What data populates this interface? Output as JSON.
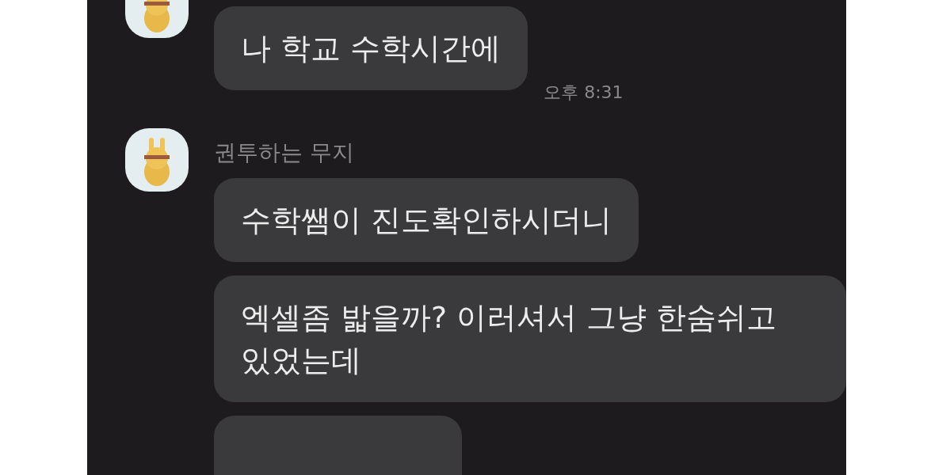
{
  "chat": {
    "groups": [
      {
        "avatar": true,
        "bubbles": [
          {
            "text": "나 학교 수학시간에",
            "time": "오후 8:31"
          }
        ]
      },
      {
        "avatar": true,
        "sender": "권투하는 무지",
        "bubbles": [
          {
            "text": "수학쌤이 진도확인하시더니"
          },
          {
            "text": "엑셀좀 밟을까? 이러셔서 그냥 한숨쉬고 있었는데"
          },
          {
            "kind": "cut"
          }
        ]
      }
    ]
  }
}
